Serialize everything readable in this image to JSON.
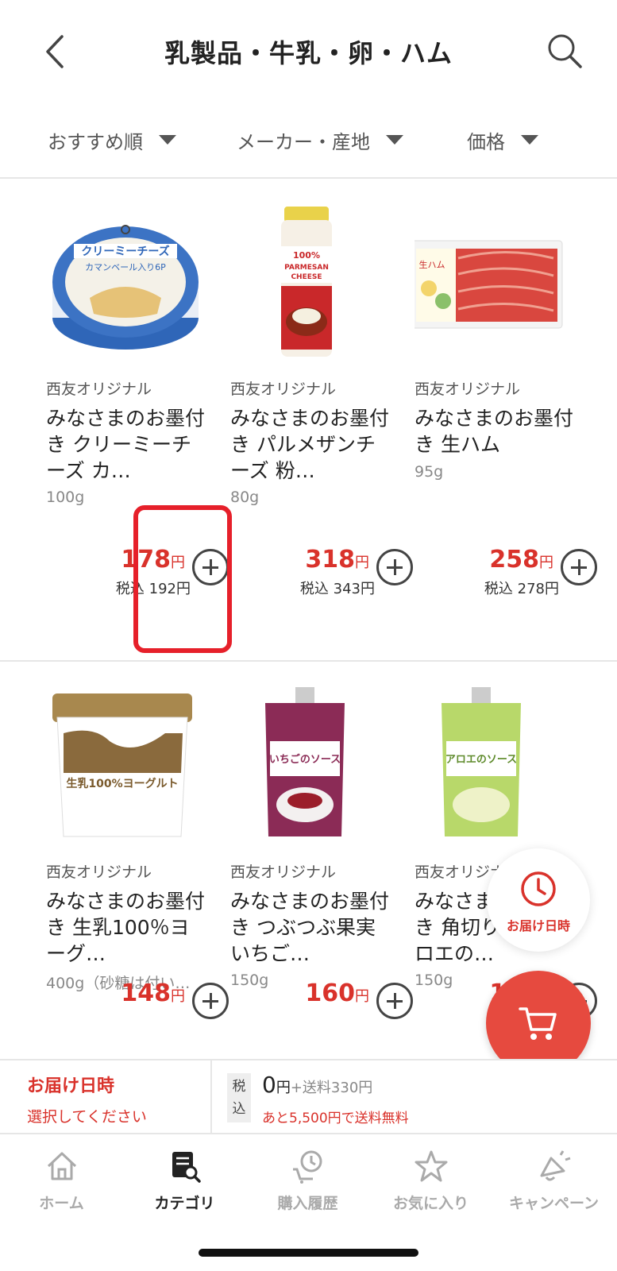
{
  "header": {
    "title": "乳製品・牛乳・卵・ハム"
  },
  "filters": [
    {
      "label": "おすすめ順"
    },
    {
      "label": "メーカー・産地"
    },
    {
      "label": "価格"
    }
  ],
  "products": [
    {
      "maker": "西友オリジナル",
      "name": "みなさまのお墨付き クリーミーチーズ カ…",
      "size": "100g",
      "price": "178",
      "yen": "円",
      "tax": "税込 192円"
    },
    {
      "maker": "西友オリジナル",
      "name": "みなさまのお墨付き パルメザンチーズ 粉…",
      "size": "80g",
      "price": "318",
      "yen": "円",
      "tax": "税込 343円"
    },
    {
      "maker": "西友オリジナル",
      "name": "みなさまのお墨付き 生ハム",
      "size": "95g",
      "price": "258",
      "yen": "円",
      "tax": "税込 278円"
    },
    {
      "maker": "西友オリジナル",
      "name": "みなさまのお墨付き 生乳100％ヨーグ…",
      "size": "400g（砂糖は付い…",
      "price": "148",
      "yen": "円"
    },
    {
      "maker": "西友オリジナル",
      "name": "みなさまのお墨付き つぶつぶ果実 いちご…",
      "size": "150g",
      "price": "160",
      "yen": "円"
    },
    {
      "maker": "西友オリジナル",
      "name": "みなさまのお墨付き 角切り果肉 アロエの…",
      "size": "150g",
      "price": "160",
      "yen": "円"
    }
  ],
  "product_image_text": {
    "cheese": "クリーミーチーズ",
    "cheese_sub": "カマンベール入り6P",
    "parmesan": "100% PARMESAN CHEESE",
    "ham": "生ハム",
    "yogurt": "生乳100%ヨーグルト",
    "strawberry": "いちごのソース",
    "aloe": "アロエのソース"
  },
  "fab": {
    "delivery_label": "お届け日時"
  },
  "delivery_bar": {
    "title": "お届け日時",
    "subtitle": "選択してください",
    "tax_badge": "税込",
    "total": "0",
    "total_yen": "円",
    "shipping": "+送料330円",
    "free_shipping": "あと5,500円で送料無料"
  },
  "tabs": [
    {
      "label": "ホーム",
      "icon": "home-icon"
    },
    {
      "label": "カテゴリ",
      "icon": "category-icon"
    },
    {
      "label": "購入履歴",
      "icon": "history-icon"
    },
    {
      "label": "お気に入り",
      "icon": "star-icon"
    },
    {
      "label": "キャンペーン",
      "icon": "campaign-icon"
    }
  ],
  "colors": {
    "accent": "#d9322b",
    "cart_button": "#e64a3f",
    "highlight": "#e6202a"
  }
}
